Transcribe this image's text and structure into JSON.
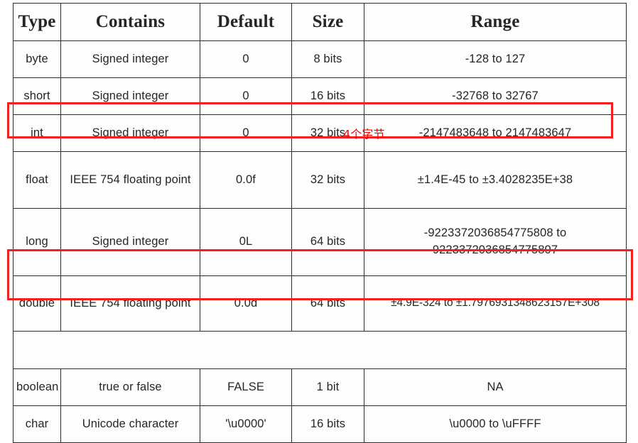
{
  "table": {
    "columns": [
      "Type",
      "Contains",
      "Default",
      "Size",
      "Range"
    ],
    "rows": [
      {
        "type": "byte",
        "contains": "Signed integer",
        "default": "0",
        "size": "8 bits",
        "range": "-128 to 127"
      },
      {
        "type": "short",
        "contains": "Signed integer",
        "default": "0",
        "size": "16 bits",
        "range": "-32768 to 32767"
      },
      {
        "type": "int",
        "contains": "Signed integer",
        "default": "0",
        "size": "32 bits",
        "range": "-2147483648 to 2147483647",
        "annotation": "4个字节"
      },
      {
        "type": "float",
        "contains": "IEEE 754 floating point",
        "default": "0.0f",
        "size": "32 bits",
        "range": "±1.4E-45 to ±3.4028235E+38"
      },
      {
        "type": "long",
        "contains": "Signed integer",
        "default": "0L",
        "size": "64 bits",
        "range": "-9223372036854775808 to 9223372036854775807"
      },
      {
        "type": "double",
        "contains": "IEEE 754 floating point",
        "default": "0.0d",
        "size": "64 bits",
        "range": "±4.9E-324 to ±1.7976931348623157E+308"
      },
      {
        "type": "",
        "contains": "",
        "default": "",
        "size": "",
        "range": ""
      },
      {
        "type": "boolean",
        "contains": "true or false",
        "default": "FALSE",
        "size": "1 bit",
        "range": "NA"
      },
      {
        "type": "char",
        "contains": "Unicode character",
        "default": "'\\u0000'",
        "size": "16 bits",
        "range": "\\u0000 to \\uFFFF"
      }
    ]
  },
  "colors": {
    "size_text": "#a8505e",
    "annotation": "#ff0000",
    "highlight_box": "#f42020",
    "grid": "#2b2b2b"
  }
}
